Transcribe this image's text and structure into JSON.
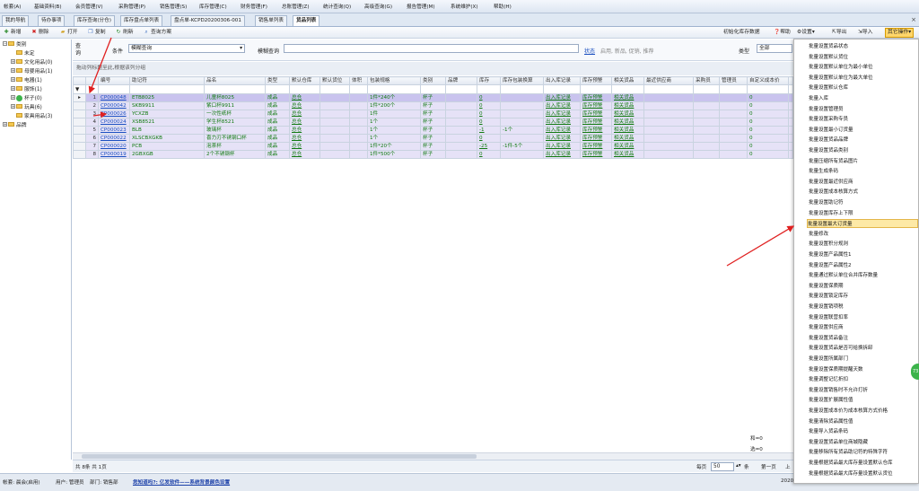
{
  "menubar": {
    "items": [
      "帐套(A)",
      "基础资料(B)",
      "会员管理(V)",
      "采购管理(P)",
      "销售管理(S)",
      "库存管理(C)",
      "财务管理(F)",
      "总账管理(Z)",
      "统计查询(Q)",
      "高级查询(G)",
      "报告管理(M)",
      "系统维护(X)",
      "帮助(H)"
    ]
  },
  "tabs": {
    "items": [
      "我的导航",
      "待办事项",
      "库存查询(分仓)",
      "库存盘点单列表",
      "盘点单-KCPD20200306-001",
      "销售单列表",
      "货品列表"
    ],
    "close_glyph": "×"
  },
  "toolbar": {
    "new": "新增",
    "delete": "删除",
    "open": "打开",
    "copy": "复制",
    "refresh": "刷新",
    "query_scheme": "查询方案",
    "init_stock": "初始化库存数据",
    "help": "帮助",
    "settings": "设置",
    "export": "导出",
    "import": "导入",
    "other_ops": "其它操作"
  },
  "tree": {
    "root": "类别",
    "children": [
      "未定",
      "文化用品(0)",
      "母婴用品(1)",
      "电器(1)",
      "服饰(1)",
      "杯子(0)",
      "玩具(6)",
      "家具用品(3)"
    ],
    "brand": "品牌"
  },
  "filter": {
    "query_label": "查询",
    "condition_label": "条件",
    "condition_value": "模糊查询",
    "fuzzy_label": "模糊查询",
    "fuzzy_value": "",
    "status_link": "状态",
    "status_hint": "启用, 新品, 促销, 推荐",
    "type_label": "类型",
    "type_value": "全部"
  },
  "group_hint": "拖动列标题至此,根据该列分组",
  "grid": {
    "headers": [
      "编号",
      "助记符",
      "品名",
      "类型",
      "默认仓库",
      "默认货位",
      "体积",
      "包装规格",
      "类别",
      "品牌",
      "库存",
      "库存包装换算",
      "出入库记录",
      "库存预警",
      "相关货品",
      "最近供应商",
      "采购员",
      "管理员",
      "自定义成本价"
    ],
    "rows": [
      {
        "n": "1",
        "code": "CP000048",
        "mnem": "ETB8025",
        "name": "儿童杯8025",
        "type": "成品",
        "wh": "总仓",
        "pack": "1件*240个",
        "cat": "杯子",
        "stock": "0",
        "conv": "",
        "record": "出入库记录",
        "warn": "库存预警",
        "rel": "相关货品",
        "cost": "0"
      },
      {
        "n": "2",
        "code": "CP000042",
        "mnem": "SKB9911",
        "name": "紫口杯9911",
        "type": "成品",
        "wh": "总仓",
        "pack": "1件*200个",
        "cat": "杯子",
        "stock": "0",
        "conv": "",
        "record": "出入库记录",
        "warn": "库存预警",
        "rel": "相关货品",
        "cost": "0"
      },
      {
        "n": "3",
        "code": "CP000026",
        "mnem": "YCXZB",
        "name": "一次性纸杯",
        "type": "成品",
        "wh": "总仓",
        "pack": "1件",
        "cat": "杯子",
        "stock": "0",
        "conv": "",
        "record": "出入库记录",
        "warn": "库存预警",
        "rel": "相关货品",
        "cost": "0"
      },
      {
        "n": "4",
        "code": "CP000024",
        "mnem": "XSB8521",
        "name": "学生杯8521",
        "type": "成品",
        "wh": "总仓",
        "pack": "1个",
        "cat": "杯子",
        "stock": "0",
        "conv": "",
        "record": "出入库记录",
        "warn": "库存预警",
        "rel": "相关货品",
        "cost": "0"
      },
      {
        "n": "5",
        "code": "CP000023",
        "mnem": "BLB",
        "name": "玻璃杯",
        "type": "成品",
        "wh": "总仓",
        "pack": "1个",
        "cat": "杯子",
        "stock": "-1",
        "conv": "-1个",
        "record": "出入库记录",
        "warn": "库存预警",
        "rel": "相关货品",
        "cost": "0"
      },
      {
        "n": "6",
        "code": "CP000022",
        "mnem": "XLSCBXGKB",
        "name": "喜力刃不锈钢口杯",
        "type": "成品",
        "wh": "总仓",
        "pack": "1个",
        "cat": "杯子",
        "stock": "0",
        "conv": "",
        "record": "出入库记录",
        "warn": "库存预警",
        "rel": "相关货品",
        "cost": "0"
      },
      {
        "n": "7",
        "code": "CP000020",
        "mnem": "PCB",
        "name": "泡茶杯",
        "type": "成品",
        "wh": "总仓",
        "pack": "1件*20个",
        "cat": "杯子",
        "stock": "-25",
        "conv": "-1件-5个",
        "record": "出入库记录",
        "warn": "库存预警",
        "rel": "相关货品",
        "cost": "0"
      },
      {
        "n": "8",
        "code": "CP000019",
        "mnem": "2GBXGB",
        "name": "2个不锈钢杯",
        "type": "成品",
        "wh": "总仓",
        "pack": "1件*500个",
        "cat": "杯子",
        "stock": "0",
        "conv": "",
        "record": "出入库记录",
        "warn": "库存预警",
        "rel": "相关货品",
        "cost": "0"
      }
    ]
  },
  "summary": {
    "sum1": "和=0",
    "sum2": "选=0"
  },
  "pager": {
    "total": "共 8条 共 1页",
    "per_page_label": "每页",
    "per_page_value": "50",
    "unit": "条",
    "first": "第一页",
    "prev": "上"
  },
  "status": {
    "account": "帐套: 晨会(启用)",
    "user": "用户: 管理员",
    "dept": "部门: 销售部",
    "link": "您知道吗?: 亿发软件——系统背景颜色设置",
    "year": "2020"
  },
  "dropdown": {
    "items": [
      "批量设置货品状态",
      "批量设置默认货位",
      "批量设置默认单位为最小单位",
      "批量设置默认单位为最大单位",
      "批量设置默认仓库",
      "批量入库",
      "批量设置管理员",
      "批量设置采购专员",
      "批量设置最小订货量",
      "批量设置货品品牌",
      "批量设置货品类别",
      "批量压缩所有货品图片",
      "批量生成条码",
      "批量设置最近供应商",
      "批量设置成本核算方式",
      "批量设置助记符",
      "批量设置库存上下限",
      "批量设置最大订货量",
      "批量修改",
      "批量设置积分规则",
      "批量设置产品属性1",
      "批量设置产品属性2",
      "批量通过默认单位合并库存数量",
      "批量设置保质期",
      "批量设置锁定库存",
      "批量设置销项税",
      "批量设置联营扣率",
      "批量设置供应商",
      "批量设置货品备注",
      "批量设置货品是否可给换拆卸",
      "批量设置所属部门",
      "批量设置保质期提醒天数",
      "批量调整记忆折扣",
      "批量设置销售时不允许打折",
      "批量设置扩展属性值",
      "批量设置成本价为成本核算方式价格",
      "批量清除货品属性值",
      "批量导入货品条码",
      "批量设置货品单位商城隐藏",
      "批量移除所有货品助记符的特殊字符",
      "批量根据货品最大库存量设置默认仓库",
      "批量根据货品最大库存量设置默认货位"
    ],
    "highlight_index": 17
  },
  "bubble": "73"
}
